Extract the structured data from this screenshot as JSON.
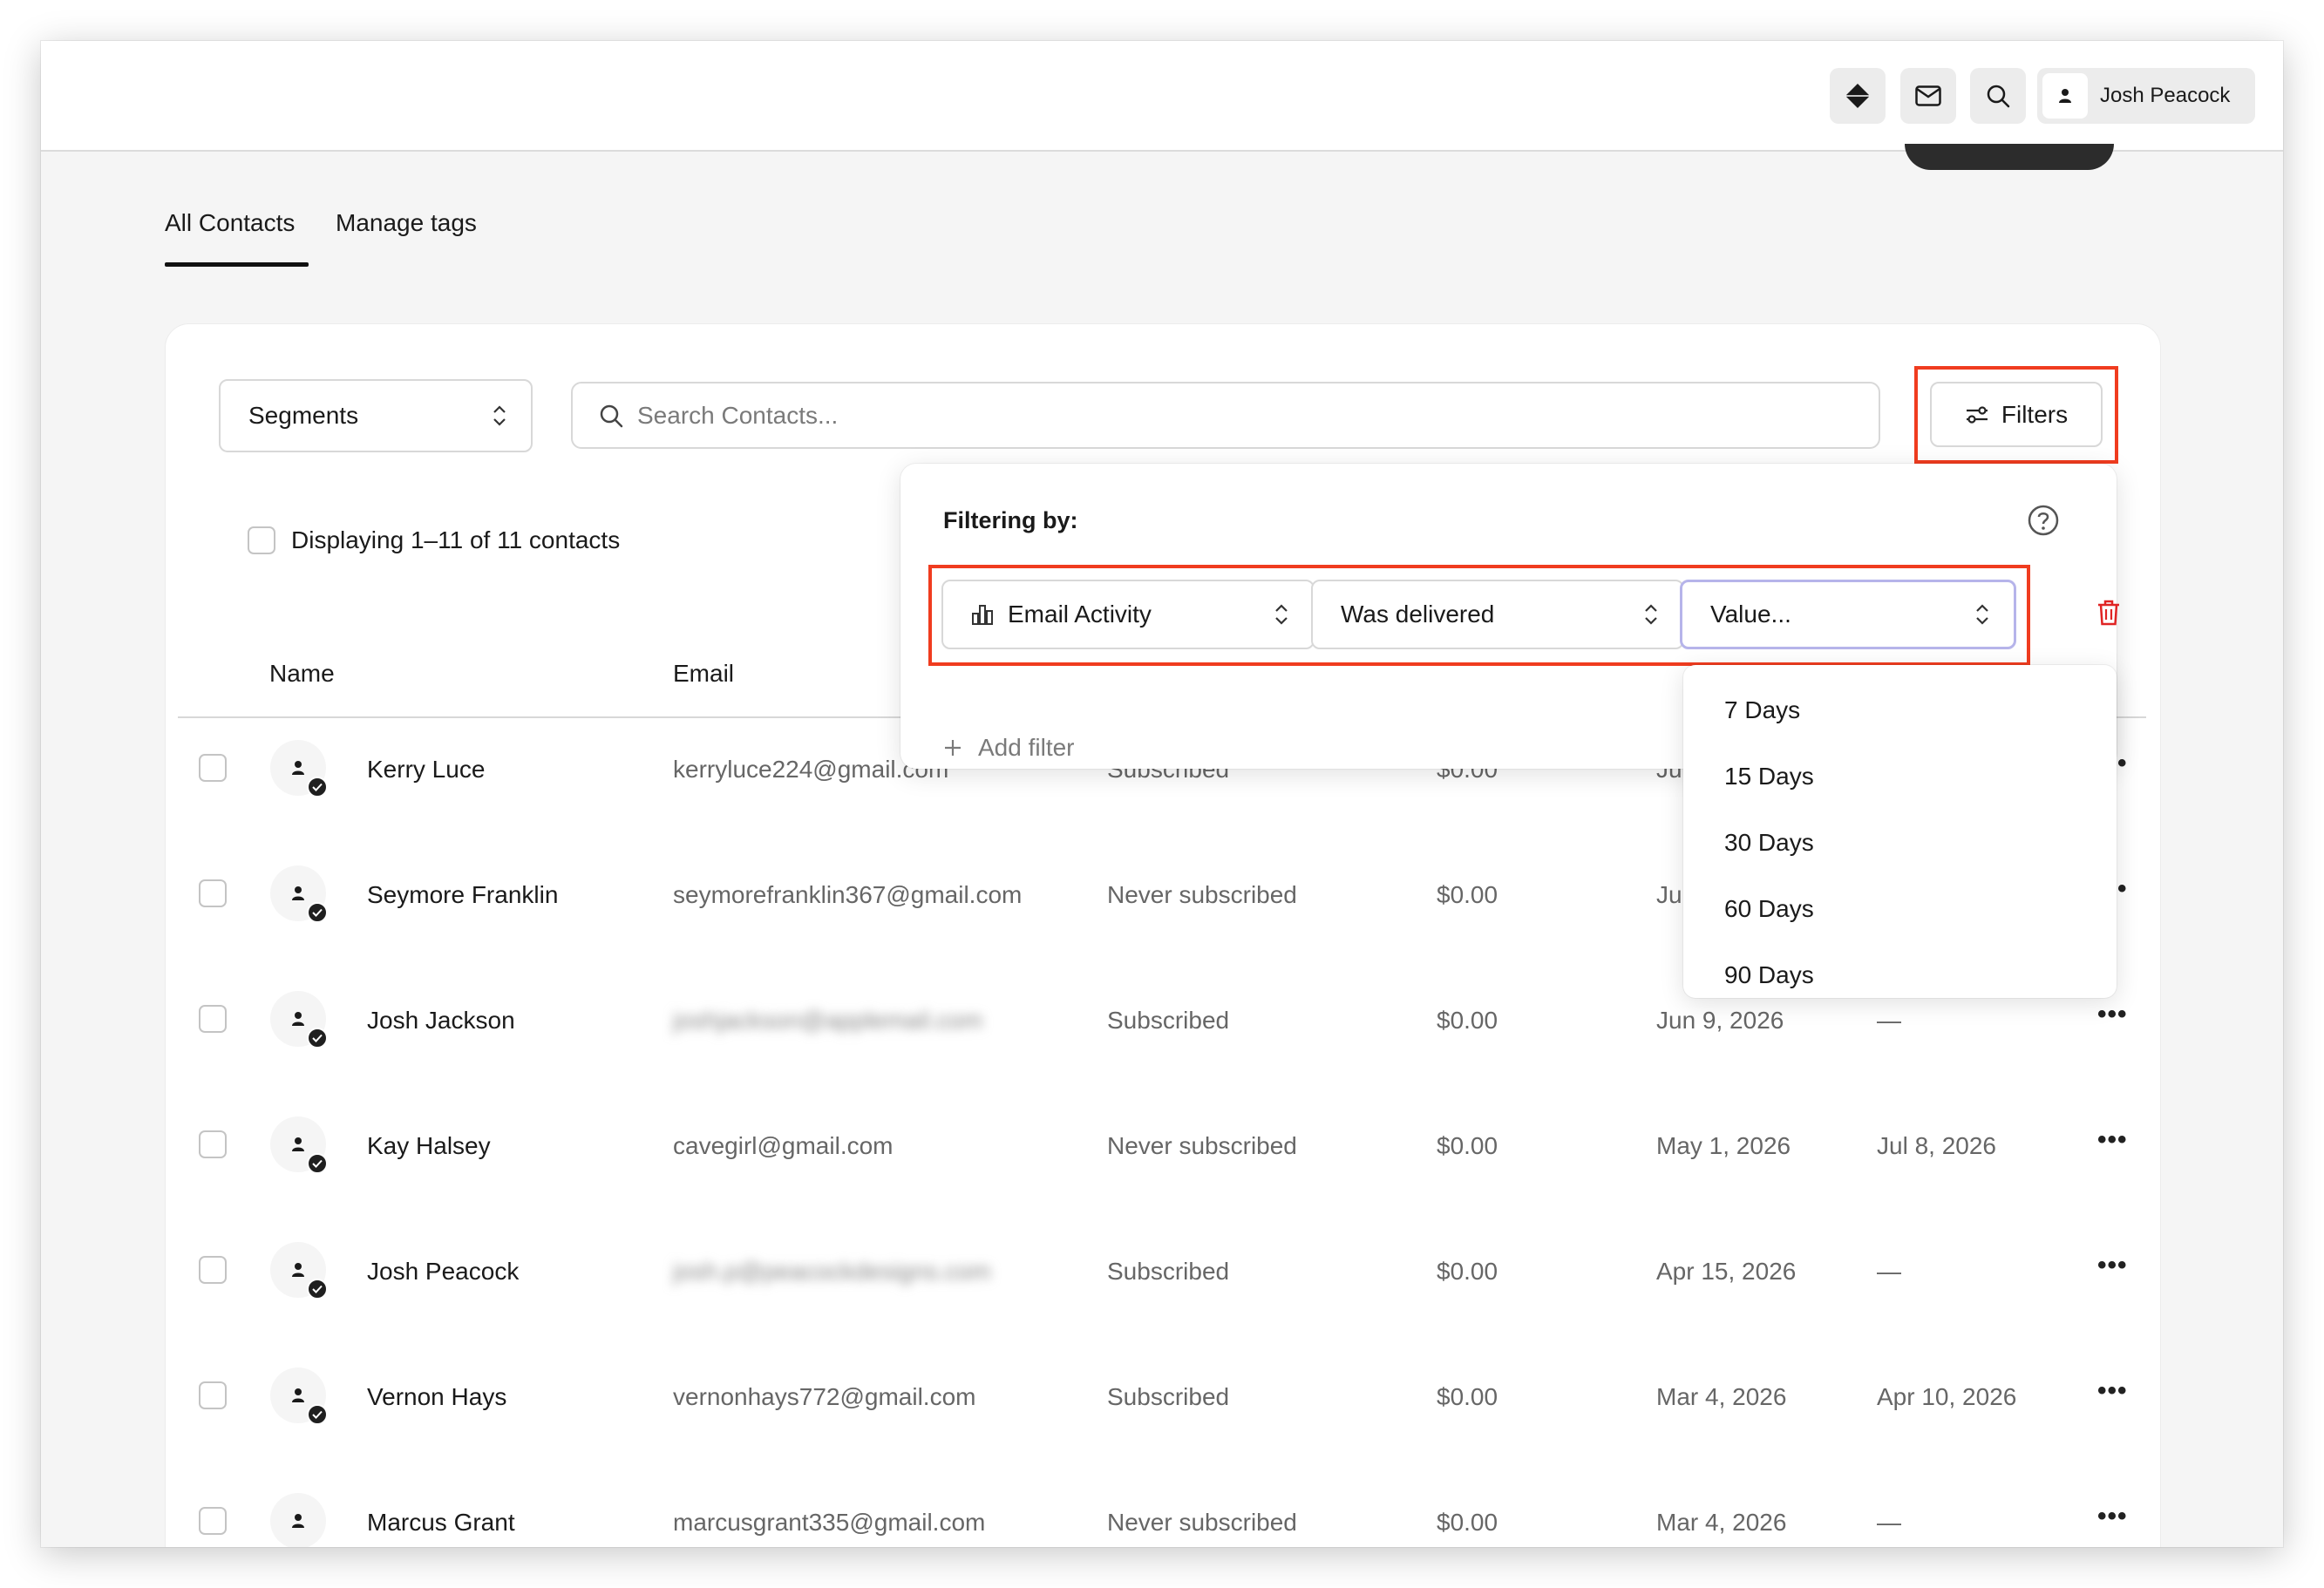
{
  "header": {
    "user_name": "Josh Peacock",
    "icons": [
      "diamond-icon",
      "mail-icon",
      "search-icon",
      "user-icon"
    ]
  },
  "tabs": [
    {
      "label": "All Contacts",
      "active": true
    },
    {
      "label": "Manage tags",
      "active": false
    }
  ],
  "toolbar": {
    "segments_label": "Segments",
    "search_placeholder": "Search Contacts...",
    "filters_label": "Filters"
  },
  "display_text": "Displaying 1–11 of 11 contacts",
  "columns": {
    "name": "Name",
    "email": "Email"
  },
  "rows": [
    {
      "name": "Kerry Luce",
      "email": "kerryluce224@gmail.com",
      "email_blurred": false,
      "status": "Subscribed",
      "amount": "$0.00",
      "date1": "Ju",
      "date2": ""
    },
    {
      "name": "Seymore Franklin",
      "email": "seymorefranklin367@gmail.com",
      "email_blurred": false,
      "status": "Never subscribed",
      "amount": "$0.00",
      "date1": "Ju",
      "date2": ""
    },
    {
      "name": "Josh Jackson",
      "email": "joshjackson@applemail.com",
      "email_blurred": true,
      "status": "Subscribed",
      "amount": "$0.00",
      "date1": "Jun 9, 2026",
      "date2": "—"
    },
    {
      "name": "Kay Halsey",
      "email": "cavegirl@gmail.com",
      "email_blurred": false,
      "status": "Never subscribed",
      "amount": "$0.00",
      "date1": "May 1, 2026",
      "date2": "Jul 8, 2026"
    },
    {
      "name": "Josh Peacock",
      "email": "josh.p@peacockdesigns.com",
      "email_blurred": true,
      "status": "Subscribed",
      "amount": "$0.00",
      "date1": "Apr 15, 2026",
      "date2": "—"
    },
    {
      "name": "Vernon Hays",
      "email": "vernonhays772@gmail.com",
      "email_blurred": false,
      "status": "Subscribed",
      "amount": "$0.00",
      "date1": "Mar 4, 2026",
      "date2": "Apr 10, 2026"
    },
    {
      "name": "Marcus Grant",
      "email": "marcusgrant335@gmail.com",
      "email_blurred": false,
      "status": "Never subscribed",
      "amount": "$0.00",
      "date1": "Mar 4, 2026",
      "date2": "—"
    }
  ],
  "filter_popover": {
    "title": "Filtering by:",
    "field": "Email Activity",
    "operator": "Was delivered",
    "value_placeholder": "Value...",
    "add_filter_label": "Add filter"
  },
  "value_options": [
    "7 Days",
    "15 Days",
    "30 Days",
    "60 Days",
    "90 Days"
  ],
  "colors": {
    "highlight": "#f03c1f",
    "trash": "#e02424",
    "active_border": "#b6b4ea"
  }
}
